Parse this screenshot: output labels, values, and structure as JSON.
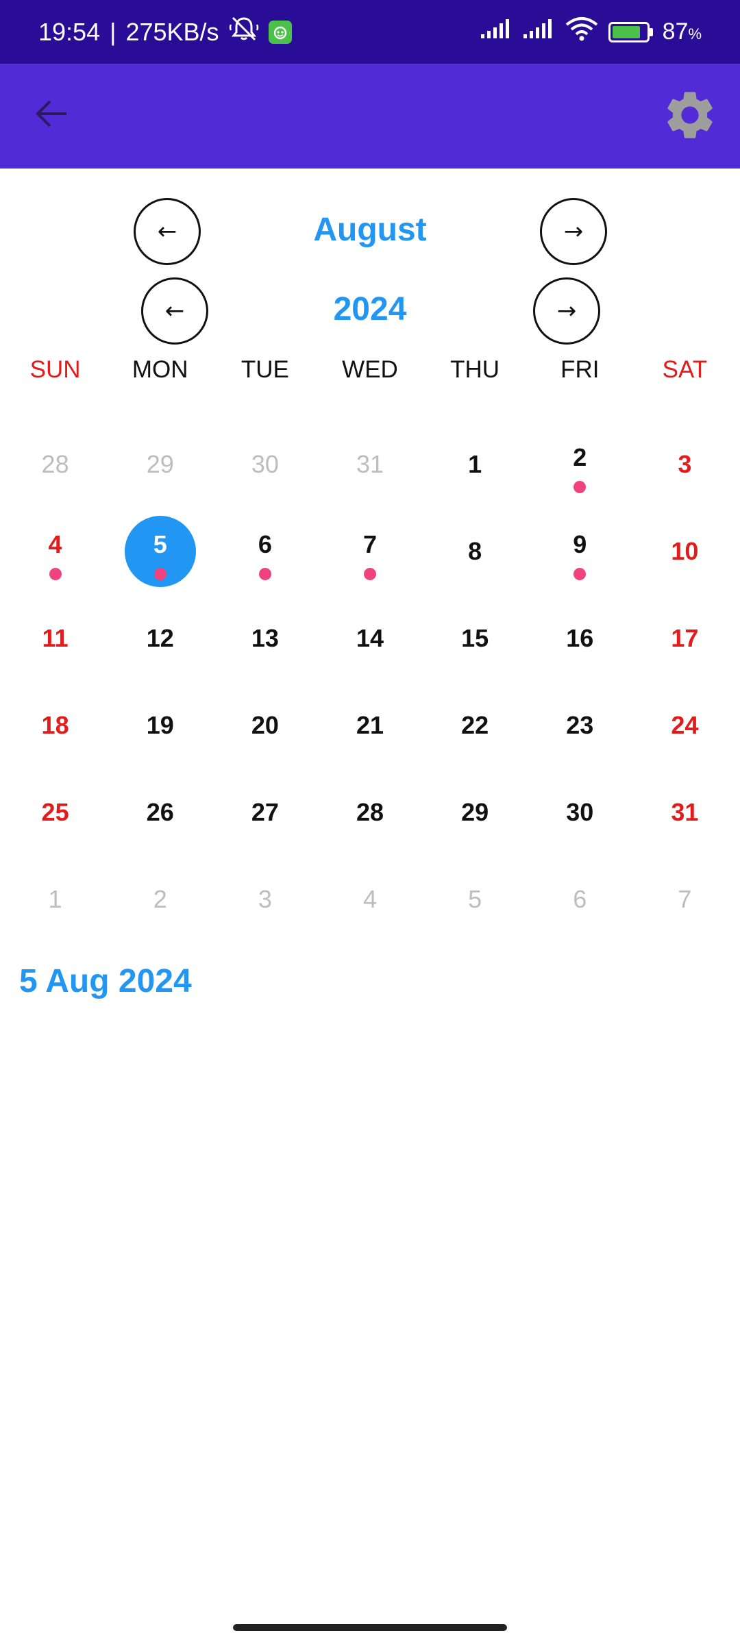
{
  "status_bar": {
    "time": "19:54",
    "separator": "|",
    "speed": "275KB/s",
    "battery": "87",
    "battery_pct_symbol": "%"
  },
  "app_bar": {
    "back_icon": "arrow-back-icon",
    "settings_icon": "gear-icon",
    "settings_icon_color": "#9e9e9e",
    "color": "#522bd6"
  },
  "nav": {
    "month": "August",
    "year": "2024",
    "prev_symbol": "←",
    "next_symbol": "→"
  },
  "weekdays": [
    "SUN",
    "MON",
    "TUE",
    "WED",
    "THU",
    "FRI",
    "SAT"
  ],
  "weeks": [
    [
      {
        "day": "28",
        "other": true
      },
      {
        "day": "29",
        "other": true
      },
      {
        "day": "30",
        "other": true
      },
      {
        "day": "31",
        "other": true
      },
      {
        "day": "1"
      },
      {
        "day": "2",
        "dot": true
      },
      {
        "day": "3",
        "weekend": true
      }
    ],
    [
      {
        "day": "4",
        "weekend": true,
        "dot": true
      },
      {
        "day": "5",
        "selected": true,
        "dot": true
      },
      {
        "day": "6",
        "dot": true
      },
      {
        "day": "7",
        "dot": true
      },
      {
        "day": "8"
      },
      {
        "day": "9",
        "dot": true
      },
      {
        "day": "10",
        "weekend": true
      }
    ],
    [
      {
        "day": "11",
        "weekend": true
      },
      {
        "day": "12"
      },
      {
        "day": "13"
      },
      {
        "day": "14"
      },
      {
        "day": "15"
      },
      {
        "day": "16"
      },
      {
        "day": "17",
        "weekend": true
      }
    ],
    [
      {
        "day": "18",
        "weekend": true
      },
      {
        "day": "19"
      },
      {
        "day": "20"
      },
      {
        "day": "21"
      },
      {
        "day": "22"
      },
      {
        "day": "23"
      },
      {
        "day": "24",
        "weekend": true
      }
    ],
    [
      {
        "day": "25",
        "weekend": true
      },
      {
        "day": "26"
      },
      {
        "day": "27"
      },
      {
        "day": "28"
      },
      {
        "day": "29"
      },
      {
        "day": "30"
      },
      {
        "day": "31",
        "weekend": true
      }
    ],
    [
      {
        "day": "1",
        "other": true
      },
      {
        "day": "2",
        "other": true
      },
      {
        "day": "3",
        "other": true
      },
      {
        "day": "4",
        "other": true
      },
      {
        "day": "5",
        "other": true
      },
      {
        "day": "6",
        "other": true
      },
      {
        "day": "7",
        "other": true
      }
    ]
  ],
  "selected_date_label": "5 Aug 2024",
  "colors": {
    "accent": "#2196f3",
    "weekend": "#e21b1b",
    "event_dot": "#f0437d",
    "status_bar": "#2a0d96"
  }
}
